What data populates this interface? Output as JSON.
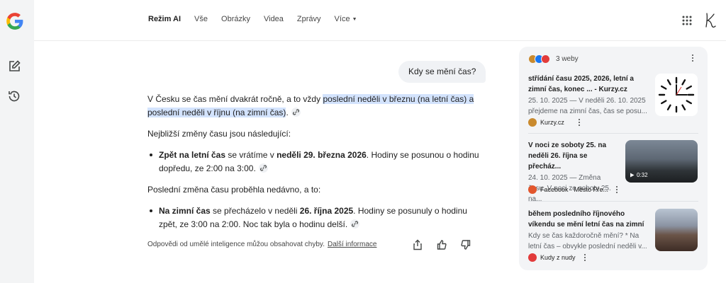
{
  "header": {
    "tabs": [
      {
        "label": "Režim AI"
      },
      {
        "label": "Vše"
      },
      {
        "label": "Obrázky"
      },
      {
        "label": "Videa"
      },
      {
        "label": "Zprávy"
      },
      {
        "label": "Více"
      }
    ],
    "avatar_letter": "K"
  },
  "query": "Kdy se mění čas?",
  "answer": {
    "p1_before": "V Česku se čas mění dvakrát ročně, a to vždy ",
    "p1_highlight": "poslední neděli v březnu (na letní čas) a poslední neděli v říjnu (na zimní čas)",
    "p1_after": ".",
    "p2": "Nejbližší změny času jsou následující:",
    "b1_bold": "Zpět na letní čas",
    "b1_mid": " se vrátíme v ",
    "b1_date": "neděli 29. března 2026",
    "b1_after": ". Hodiny se posunou o hodinu dopředu, ze 2:00 na 3:00.",
    "p3": "Poslední změna času proběhla nedávno, a to:",
    "b2_bold": "Na zimní čas",
    "b2_mid": " se přecházelo v neděli ",
    "b2_date": "26. října 2025",
    "b2_after": ". Hodiny se posunuly o hodinu zpět, ze 3:00 na 2:00. Noc tak byla o hodinu delší."
  },
  "footer": {
    "disclaimer": "Odpovědi od umělé inteligence můžou obsahovat chyby.",
    "more_link": "Další informace"
  },
  "sources": {
    "count_label": "3 weby",
    "items": [
      {
        "title": "střídání času 2025, 2026, letní a zimní čas, konec ... - Kurzy.cz",
        "snippet": "25. 10. 2025 — V neděli 26. 10. 2025 přejdeme na zimní čas, čas se posu...",
        "site": "Kurzy.cz",
        "color": "#c98a2e"
      },
      {
        "title": "V noci ze soboty 25. na neděli 26. října se přecház...",
        "snippet": "24. 10. 2025 — Změna času. V noci ze soboty 25. na...",
        "site": "Facebook · Město Pře...",
        "duration": "0:32",
        "color": "#e2562d"
      },
      {
        "title": "během posledního říjnového víkendu se mění letní čas na zimní",
        "snippet": "Kdy se čas každoročně mění? * Na letní čas – obvykle poslední neděli v...",
        "site": "Kudy z nudy",
        "color": "#e23b3b"
      }
    ]
  }
}
